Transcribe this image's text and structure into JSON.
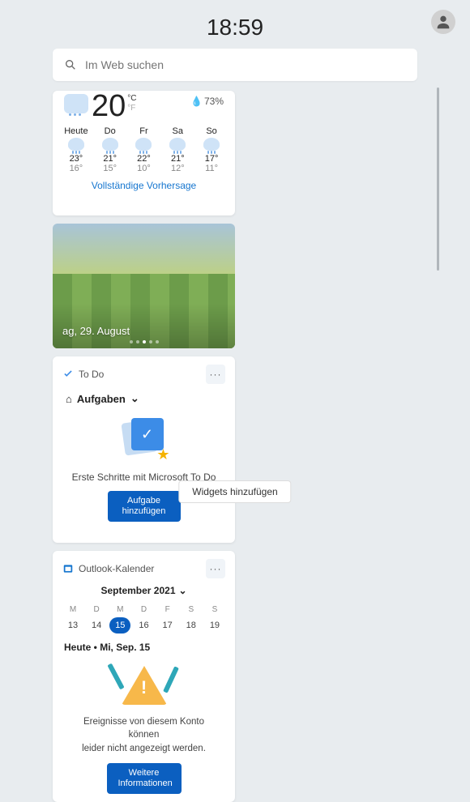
{
  "header": {
    "time": "18:59"
  },
  "search": {
    "placeholder": "Im Web suchen"
  },
  "weather": {
    "temp": "20",
    "deg": "°C",
    "alt_unit": "°F",
    "humidity": "73%",
    "days": [
      {
        "label": "Heute",
        "hi": "23°",
        "lo": "16°"
      },
      {
        "label": "Do",
        "hi": "21°",
        "lo": "15°"
      },
      {
        "label": "Fr",
        "hi": "22°",
        "lo": "10°"
      },
      {
        "label": "Sa",
        "hi": "21°",
        "lo": "12°"
      },
      {
        "label": "So",
        "hi": "17°",
        "lo": "11°"
      }
    ],
    "link": "Vollständige Vorhersage"
  },
  "photo": {
    "caption": "ag, 29. August"
  },
  "todo": {
    "title": "To Do",
    "list_label": "Aufgaben",
    "message": "Erste Schritte mit Microsoft To Do",
    "button_l1": "Aufgabe",
    "button_l2": "hinzufügen"
  },
  "calendar": {
    "title": "Outlook-Kalender",
    "month": "September 2021",
    "dow": [
      "M",
      "D",
      "M",
      "D",
      "F",
      "S",
      "S"
    ],
    "days": [
      "13",
      "14",
      "15",
      "16",
      "17",
      "18",
      "19"
    ],
    "selected": "15",
    "today_label": "Heute • Mi, Sep. 15",
    "error_l1": "Ereignisse von diesem Konto können",
    "error_l2": "leider nicht angezeigt werden.",
    "button_l1": "Weitere",
    "button_l2": "Informationen"
  },
  "footer": {
    "add_widgets": "Widgets hinzufügen"
  }
}
